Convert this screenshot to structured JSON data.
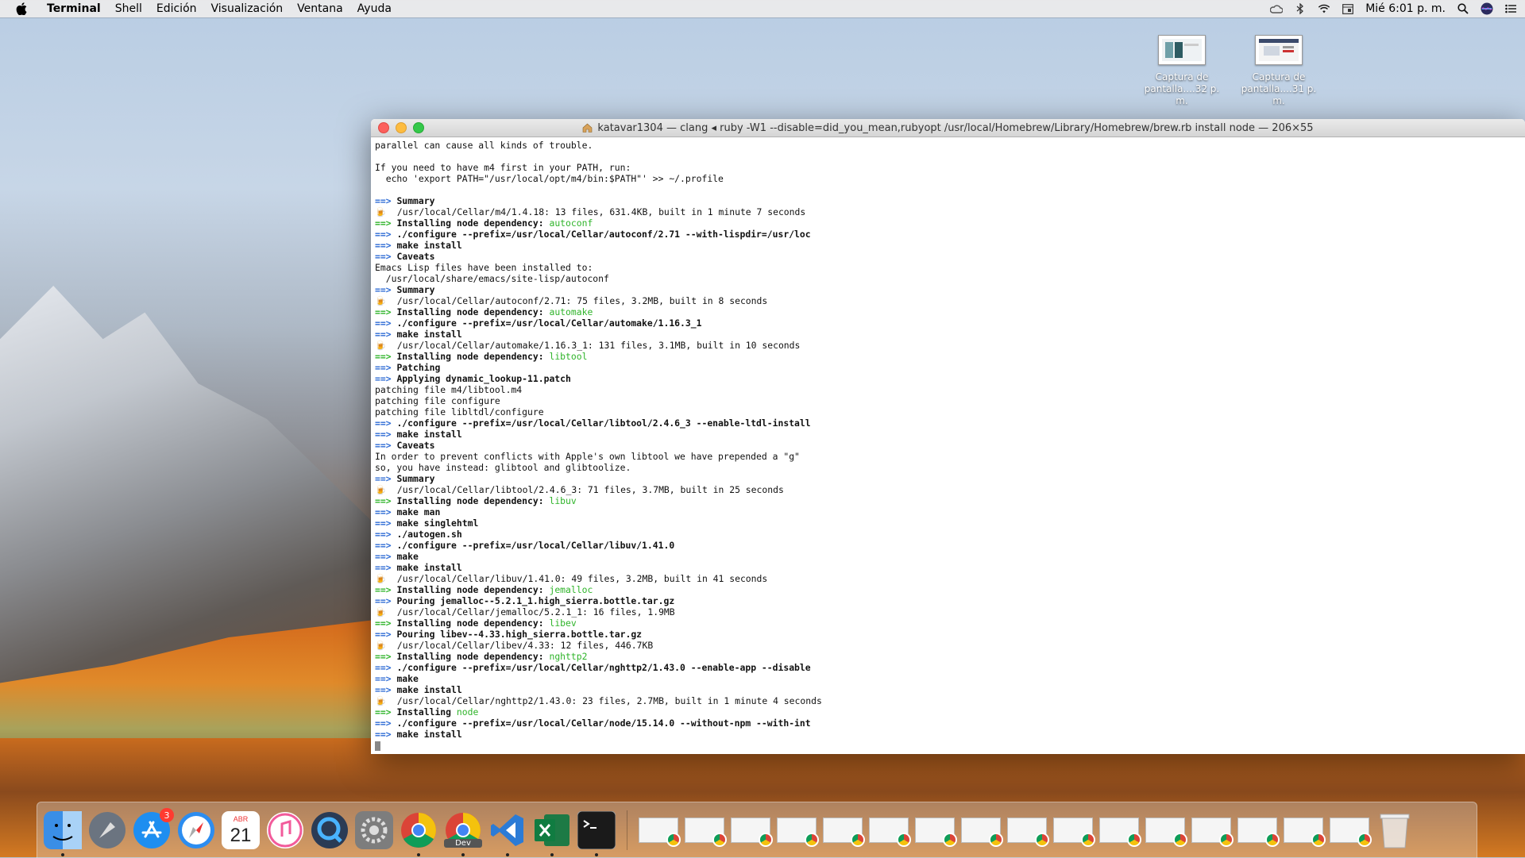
{
  "menubar": {
    "app": "Terminal",
    "items": [
      "Shell",
      "Edición",
      "Visualización",
      "Ventana",
      "Ayuda"
    ],
    "clock": "Mié 6:01 p. m.",
    "status_icons": [
      "creative-cloud-icon",
      "bluetooth-icon",
      "wifi-icon",
      "calendar-icon",
      "spotlight-icon",
      "siri-icon",
      "notification-center-icon"
    ]
  },
  "desktop": {
    "icons": [
      {
        "line1": "Captura de",
        "line2": "pantalla....32 p. m."
      },
      {
        "line1": "Captura de",
        "line2": "pantalla....31 p. m."
      }
    ]
  },
  "window": {
    "title": "katavar1304 — clang ◂ ruby -W1 --disable=did_you_mean,rubyopt /usr/local/Homebrew/Library/Homebrew/brew.rb install node — 206×55"
  },
  "terminal": {
    "lines": [
      {
        "t": "plain",
        "text": "parallel can cause all kinds of trouble."
      },
      {
        "t": "plain",
        "text": ""
      },
      {
        "t": "plain",
        "text": "If you need to have m4 first in your PATH, run:"
      },
      {
        "t": "plain",
        "text": "  echo 'export PATH=\"/usr/local/opt/m4/bin:$PATH\"' >> ~/.profile"
      },
      {
        "t": "plain",
        "text": ""
      },
      {
        "t": "head",
        "text": "Summary"
      },
      {
        "t": "beer",
        "text": "/usr/local/Cellar/m4/1.4.18: 13 files, 631.4KB, built in 1 minute 7 seconds"
      },
      {
        "t": "dep",
        "text": "Installing node dependency: ",
        "pkg": "autoconf"
      },
      {
        "t": "head",
        "text": "./configure --prefix=/usr/local/Cellar/autoconf/2.71 --with-lispdir=/usr/loc"
      },
      {
        "t": "head",
        "text": "make install"
      },
      {
        "t": "head",
        "text": "Caveats"
      },
      {
        "t": "plain",
        "text": "Emacs Lisp files have been installed to:"
      },
      {
        "t": "plain",
        "text": "  /usr/local/share/emacs/site-lisp/autoconf"
      },
      {
        "t": "head",
        "text": "Summary"
      },
      {
        "t": "beer",
        "text": "/usr/local/Cellar/autoconf/2.71: 75 files, 3.2MB, built in 8 seconds"
      },
      {
        "t": "dep",
        "text": "Installing node dependency: ",
        "pkg": "automake"
      },
      {
        "t": "head",
        "text": "./configure --prefix=/usr/local/Cellar/automake/1.16.3_1"
      },
      {
        "t": "head",
        "text": "make install"
      },
      {
        "t": "beer",
        "text": "/usr/local/Cellar/automake/1.16.3_1: 131 files, 3.1MB, built in 10 seconds"
      },
      {
        "t": "dep",
        "text": "Installing node dependency: ",
        "pkg": "libtool"
      },
      {
        "t": "head",
        "text": "Patching"
      },
      {
        "t": "head",
        "text": "Applying dynamic_lookup-11.patch"
      },
      {
        "t": "plain",
        "text": "patching file m4/libtool.m4"
      },
      {
        "t": "plain",
        "text": "patching file configure"
      },
      {
        "t": "plain",
        "text": "patching file libltdl/configure"
      },
      {
        "t": "head",
        "text": "./configure --prefix=/usr/local/Cellar/libtool/2.4.6_3 --enable-ltdl-install"
      },
      {
        "t": "head",
        "text": "make install"
      },
      {
        "t": "head",
        "text": "Caveats"
      },
      {
        "t": "plain",
        "text": "In order to prevent conflicts with Apple's own libtool we have prepended a \"g\""
      },
      {
        "t": "plain",
        "text": "so, you have instead: glibtool and glibtoolize."
      },
      {
        "t": "head",
        "text": "Summary"
      },
      {
        "t": "beer",
        "text": "/usr/local/Cellar/libtool/2.4.6_3: 71 files, 3.7MB, built in 25 seconds"
      },
      {
        "t": "dep",
        "text": "Installing node dependency: ",
        "pkg": "libuv"
      },
      {
        "t": "head",
        "text": "make man"
      },
      {
        "t": "head",
        "text": "make singlehtml"
      },
      {
        "t": "head",
        "text": "./autogen.sh"
      },
      {
        "t": "head",
        "text": "./configure --prefix=/usr/local/Cellar/libuv/1.41.0"
      },
      {
        "t": "head",
        "text": "make"
      },
      {
        "t": "head",
        "text": "make install"
      },
      {
        "t": "beer",
        "text": "/usr/local/Cellar/libuv/1.41.0: 49 files, 3.2MB, built in 41 seconds"
      },
      {
        "t": "dep",
        "text": "Installing node dependency: ",
        "pkg": "jemalloc"
      },
      {
        "t": "head",
        "text": "Pouring jemalloc--5.2.1_1.high_sierra.bottle.tar.gz"
      },
      {
        "t": "beer",
        "text": "/usr/local/Cellar/jemalloc/5.2.1_1: 16 files, 1.9MB"
      },
      {
        "t": "dep",
        "text": "Installing node dependency: ",
        "pkg": "libev"
      },
      {
        "t": "head",
        "text": "Pouring libev--4.33.high_sierra.bottle.tar.gz"
      },
      {
        "t": "beer",
        "text": "/usr/local/Cellar/libev/4.33: 12 files, 446.7KB"
      },
      {
        "t": "dep",
        "text": "Installing node dependency: ",
        "pkg": "nghttp2"
      },
      {
        "t": "head",
        "text": "./configure --prefix=/usr/local/Cellar/nghttp2/1.43.0 --enable-app --disable"
      },
      {
        "t": "head",
        "text": "make"
      },
      {
        "t": "head",
        "text": "make install"
      },
      {
        "t": "beer",
        "text": "/usr/local/Cellar/nghttp2/1.43.0: 23 files, 2.7MB, built in 1 minute 4 seconds"
      },
      {
        "t": "dep",
        "text": "Installing ",
        "pkg": "node"
      },
      {
        "t": "head",
        "text": "./configure --prefix=/usr/local/Cellar/node/15.14.0 --without-npm --with-int"
      },
      {
        "t": "head",
        "text": "make install"
      }
    ],
    "arrow": "==>",
    "beer_glyph": "🍺"
  },
  "dock": {
    "apps": [
      {
        "name": "finder",
        "color": "#3a8ee6"
      },
      {
        "name": "launchpad",
        "color": "#6b7480"
      },
      {
        "name": "app-store",
        "color": "#1e8ef0",
        "badge": "3"
      },
      {
        "name": "safari",
        "color": "#2c8df0"
      },
      {
        "name": "calendar",
        "color": "#ffffff",
        "month": "ABR",
        "day": "21"
      },
      {
        "name": "itunes",
        "color": "#f25b9b"
      },
      {
        "name": "quicktime",
        "color": "#2a3b55"
      },
      {
        "name": "system-preferences",
        "color": "#7d7d7d"
      },
      {
        "name": "chrome",
        "color": "#ffffff"
      },
      {
        "name": "chrome-dev",
        "color": "#ffffff",
        "label": "Dev"
      },
      {
        "name": "vscode",
        "color": "#2b7bd6"
      },
      {
        "name": "excel",
        "color": "#1d7a45"
      },
      {
        "name": "terminal",
        "color": "#1a1a1a"
      }
    ],
    "window_count": 16
  }
}
